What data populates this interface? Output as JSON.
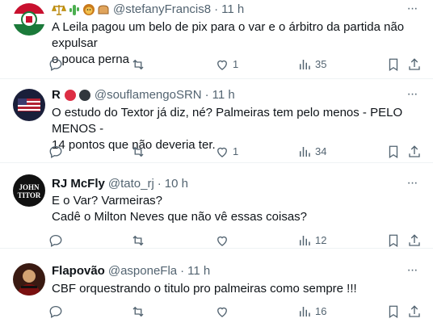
{
  "tweets": [
    {
      "name": "",
      "handle": "@stefanyFrancis8",
      "time": "11 h",
      "text": "A Leila pagou um belo de pix para o var e o árbitro da partida não expulsar\no pouca perna",
      "replies": "",
      "retweets": "",
      "likes": "1",
      "views": "35",
      "avatar_colors": [
        "#c8102e",
        "#ffffff",
        "#1b7a3a"
      ]
    },
    {
      "name": "R",
      "handle": "@souflamengoSRN",
      "time": "11 h",
      "text": "O estudo do Textor já diz, né? Palmeiras tem pelo menos - PELO MENOS -\n14 pontos que não deveria ter.",
      "replies": "",
      "retweets": "",
      "likes": "1",
      "views": "34",
      "avatar_colors": [
        "#1a1f3a",
        "#b22234",
        "#ffffff"
      ]
    },
    {
      "name": "RJ McFly",
      "handle": "@tato_rj",
      "time": "10 h",
      "text": "E o Var? Varmeiras?\nCadê o Milton Neves que não vê essas coisas?",
      "replies": "",
      "retweets": "",
      "likes": "",
      "views": "12",
      "avatar_colors": [
        "#111111",
        "#ffffff"
      ]
    },
    {
      "name": "Flapovão",
      "handle": "@asponeFla",
      "time": "11 h",
      "text": "CBF orquestrando o titulo pro palmeiras como sempre !!!",
      "replies": "",
      "retweets": "",
      "likes": "",
      "views": "16",
      "avatar_colors": [
        "#7a1010",
        "#d4a373"
      ]
    }
  ],
  "separator": "·",
  "icons": [
    "reply-icon",
    "retweet-icon",
    "like-icon",
    "views-icon",
    "bookmark-icon",
    "share-icon",
    "more-icon"
  ],
  "accent": "#536471"
}
